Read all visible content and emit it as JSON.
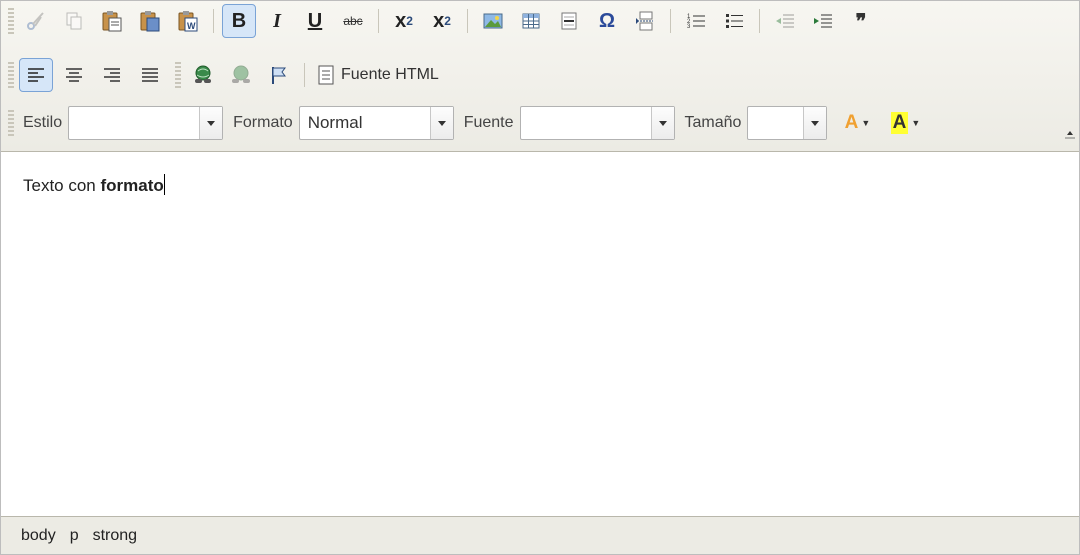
{
  "toolbar": {
    "row1": {
      "cut": "cut-icon",
      "copy": "copy-icon",
      "paste": "paste-icon",
      "paste_text": "paste-text-icon",
      "paste_word": "paste-word-icon",
      "bold_label": "B",
      "italic_label": "I",
      "underline_label": "U",
      "strike_label": "abc",
      "subscript_base": "x",
      "subscript_label": "2",
      "superscript_base": "x",
      "superscript_label": "2",
      "image": "image-icon",
      "table": "table-icon",
      "hline": "horizontal-line-icon",
      "special_char_label": "Ω",
      "page_break": "page-break-icon",
      "numbered_list": "numbered-list-icon",
      "bulleted_list": "bulleted-list-icon",
      "outdent": "outdent-icon",
      "indent": "indent-icon",
      "blockquote_label": "❞"
    },
    "row2": {
      "align_left": "align-left-icon",
      "align_center": "align-center-icon",
      "align_right": "align-right-icon",
      "align_justify": "justify-icon",
      "link": "link-icon",
      "unlink": "unlink-icon",
      "anchor": "anchor-flag-icon",
      "source_label": "Fuente HTML"
    },
    "row3": {
      "style_label": "Estilo",
      "style_value": "",
      "format_label": "Formato",
      "format_value": "Normal",
      "font_label": "Fuente",
      "font_value": "",
      "size_label": "Tamaño",
      "size_value": "",
      "text_color_label": "A",
      "bg_color_label": "A"
    }
  },
  "content": {
    "plain_text": "Texto con ",
    "bold_text": "formato"
  },
  "statusbar": {
    "path": [
      "body",
      "p",
      "strong"
    ]
  },
  "colors": {
    "toolbar_bg": "#ecebe4",
    "active_button": "#d6e6f8",
    "active_border": "#7aa3d6",
    "text_color_icon": "#f0a030",
    "bg_color_highlight": "#ffff33"
  }
}
